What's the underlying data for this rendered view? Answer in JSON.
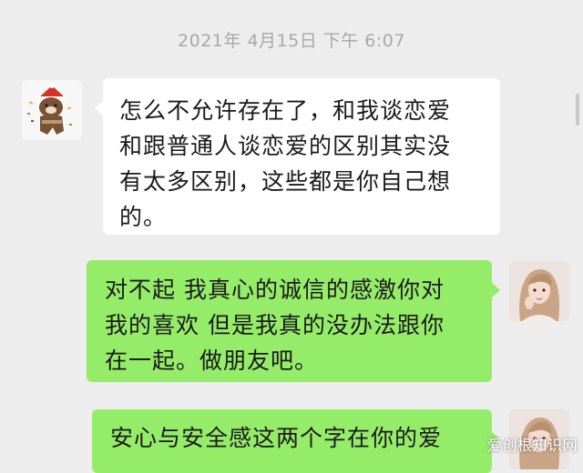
{
  "conversation": {
    "timestamp": "2021年 4月15日 下午 6:07",
    "messages": [
      {
        "direction": "incoming",
        "avatar": "cartoon-bear-santa-hat",
        "lines": [
          "怎么不允许存在了，和我谈恋爱",
          "和跟普通人谈恋爱的区别其实没",
          "有太多区别，这些都是你自己想",
          "的。"
        ]
      },
      {
        "direction": "outgoing",
        "avatar": "girl-portrait",
        "lines": [
          "对不起 我真心的诚信的感激你对",
          "我的喜欢 但是我真的没办法跟你",
          "在一起。做朋友吧。"
        ]
      },
      {
        "direction": "outgoing",
        "avatar": "girl-portrait",
        "lines": [
          "安心与安全感这两个字在你的爱"
        ]
      }
    ]
  },
  "watermark": "爱创根知识网",
  "colors": {
    "background": "#ededed",
    "incoming_bubble": "#ffffff",
    "outgoing_bubble": "#95ec69",
    "timestamp": "#a8a8a8"
  }
}
